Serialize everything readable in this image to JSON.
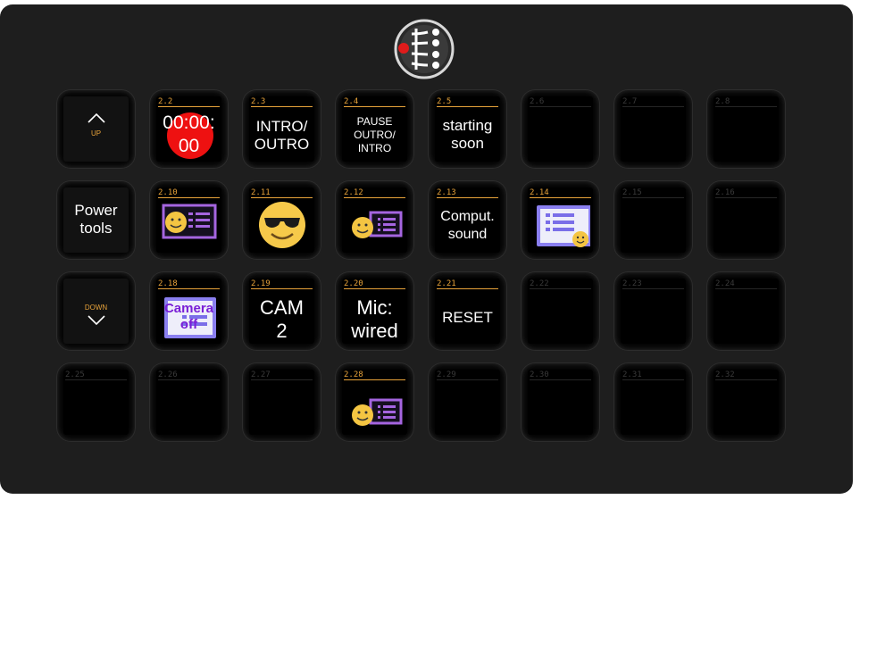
{
  "deck": {
    "colors": {
      "panel": "#1e1e1e",
      "label": "#e8a33a",
      "purple": "#8a56e2",
      "record_red": "#ee1111"
    }
  },
  "nav": {
    "up": {
      "label": "UP",
      "icon": "chevron-up-icon"
    },
    "down": {
      "label": "DOWN",
      "icon": "chevron-down-icon"
    },
    "power": {
      "text": "Power\ntools"
    }
  },
  "buttons": {
    "b2_2": {
      "id": "2.2",
      "text": "00:00:\n00",
      "icon": "record-circle-icon"
    },
    "b2_3": {
      "id": "2.3",
      "text": "INTRO/\nOUTRO"
    },
    "b2_4": {
      "id": "2.4",
      "text": "PAUSE\nOUTRO/\nINTRO"
    },
    "b2_5": {
      "id": "2.5",
      "text": "starting\nsoon"
    },
    "b2_6": {
      "id": "2.6"
    },
    "b2_7": {
      "id": "2.7"
    },
    "b2_8": {
      "id": "2.8"
    },
    "b2_10": {
      "id": "2.10",
      "icon": "face-slide-icon"
    },
    "b2_11": {
      "id": "2.11",
      "icon": "sunglasses-emoji-icon"
    },
    "b2_12": {
      "id": "2.12",
      "icon": "face-slide-icon"
    },
    "b2_13": {
      "id": "2.13",
      "text": "Comput.\nsound"
    },
    "b2_14": {
      "id": "2.14",
      "icon": "slide-face-icon"
    },
    "b2_15": {
      "id": "2.15"
    },
    "b2_16": {
      "id": "2.16"
    },
    "b2_18": {
      "id": "2.18",
      "text": "Camera\noff",
      "icon": "slide-icon"
    },
    "b2_19": {
      "id": "2.19",
      "text": "CAM\n2"
    },
    "b2_20": {
      "id": "2.20",
      "text": "Mic:\nwired"
    },
    "b2_21": {
      "id": "2.21",
      "text": "RESET"
    },
    "b2_22": {
      "id": "2.22"
    },
    "b2_23": {
      "id": "2.23"
    },
    "b2_24": {
      "id": "2.24"
    },
    "b2_25": {
      "id": "2.25"
    },
    "b2_26": {
      "id": "2.26"
    },
    "b2_27": {
      "id": "2.27"
    },
    "b2_28": {
      "id": "2.28",
      "icon": "face-slide-icon"
    },
    "b2_29": {
      "id": "2.29"
    },
    "b2_30": {
      "id": "2.30"
    },
    "b2_31": {
      "id": "2.31"
    },
    "b2_32": {
      "id": "2.32"
    }
  }
}
